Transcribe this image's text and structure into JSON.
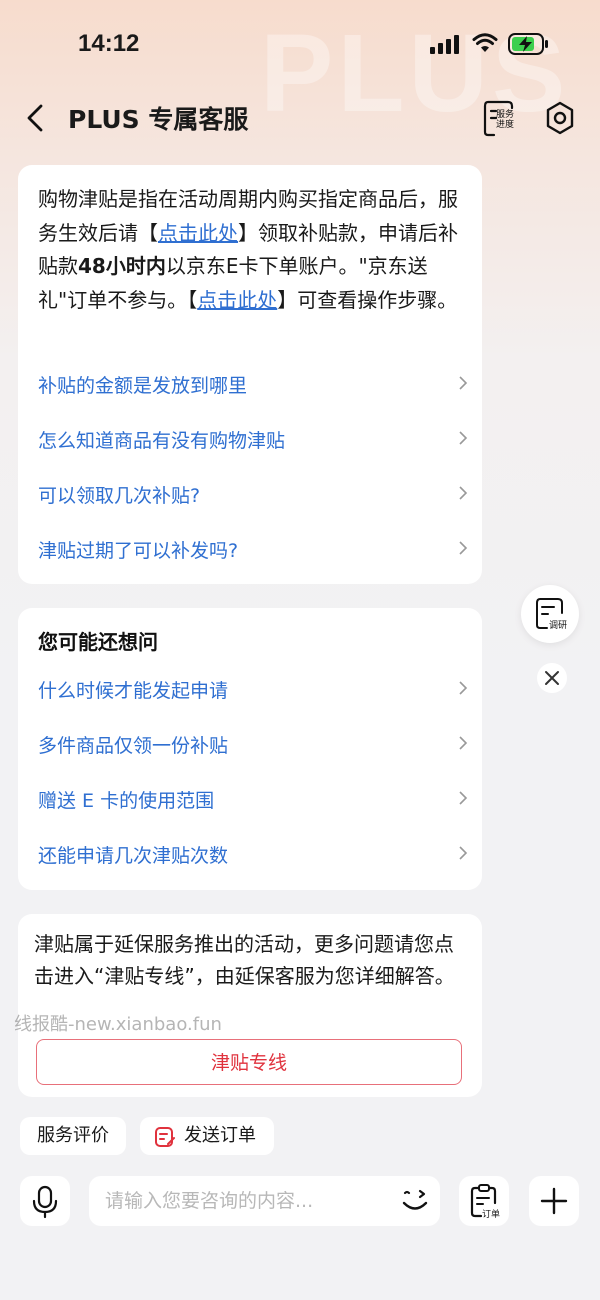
{
  "status_bar": {
    "time": "14:12"
  },
  "background_text": "PLUS",
  "nav": {
    "title": "PLUS 专属客服",
    "service_progress_label": "服务进度"
  },
  "card1": {
    "paragraph": {
      "t1": "购物津贴是指在活动周期内购买指定商品后，服务生效后请【",
      "link1": "点击此处",
      "t2": "】领取补贴款，申请后补贴款",
      "bold": "48小时内",
      "t3": "以京东E卡下单账户。\"京东送礼\"订单不参与。【",
      "link2": "点击此处",
      "t4": "】可查看操作步骤。"
    },
    "questions": [
      "补贴的金额是发放到哪里",
      "怎么知道商品有没有购物津贴",
      "可以领取几次补贴?",
      "津贴过期了可以补发吗?"
    ]
  },
  "card2": {
    "heading": "您可能还想问",
    "questions": [
      "什么时候才能发起申请",
      "多件商品仅领一份补贴",
      "赠送 E 卡的使用范围",
      "还能申请几次津贴次数"
    ]
  },
  "card3": {
    "text": "津贴属于延保服务推出的活动，更多问题请您点击进入“津贴专线”，由延保客服为您详细解答。",
    "button": "津贴专线"
  },
  "watermark": "线报酷-new.xianbao.fun",
  "floating": {
    "survey_label": "调研"
  },
  "chips": {
    "rate": "服务评价",
    "send_order": "发送订单"
  },
  "input_bar": {
    "placeholder": "请输入您要咨询的内容...",
    "order_label": "订单"
  },
  "colors": {
    "link": "#2f6fd1",
    "accent_red": "#e0323d",
    "battery_green": "#3ccf4e"
  }
}
